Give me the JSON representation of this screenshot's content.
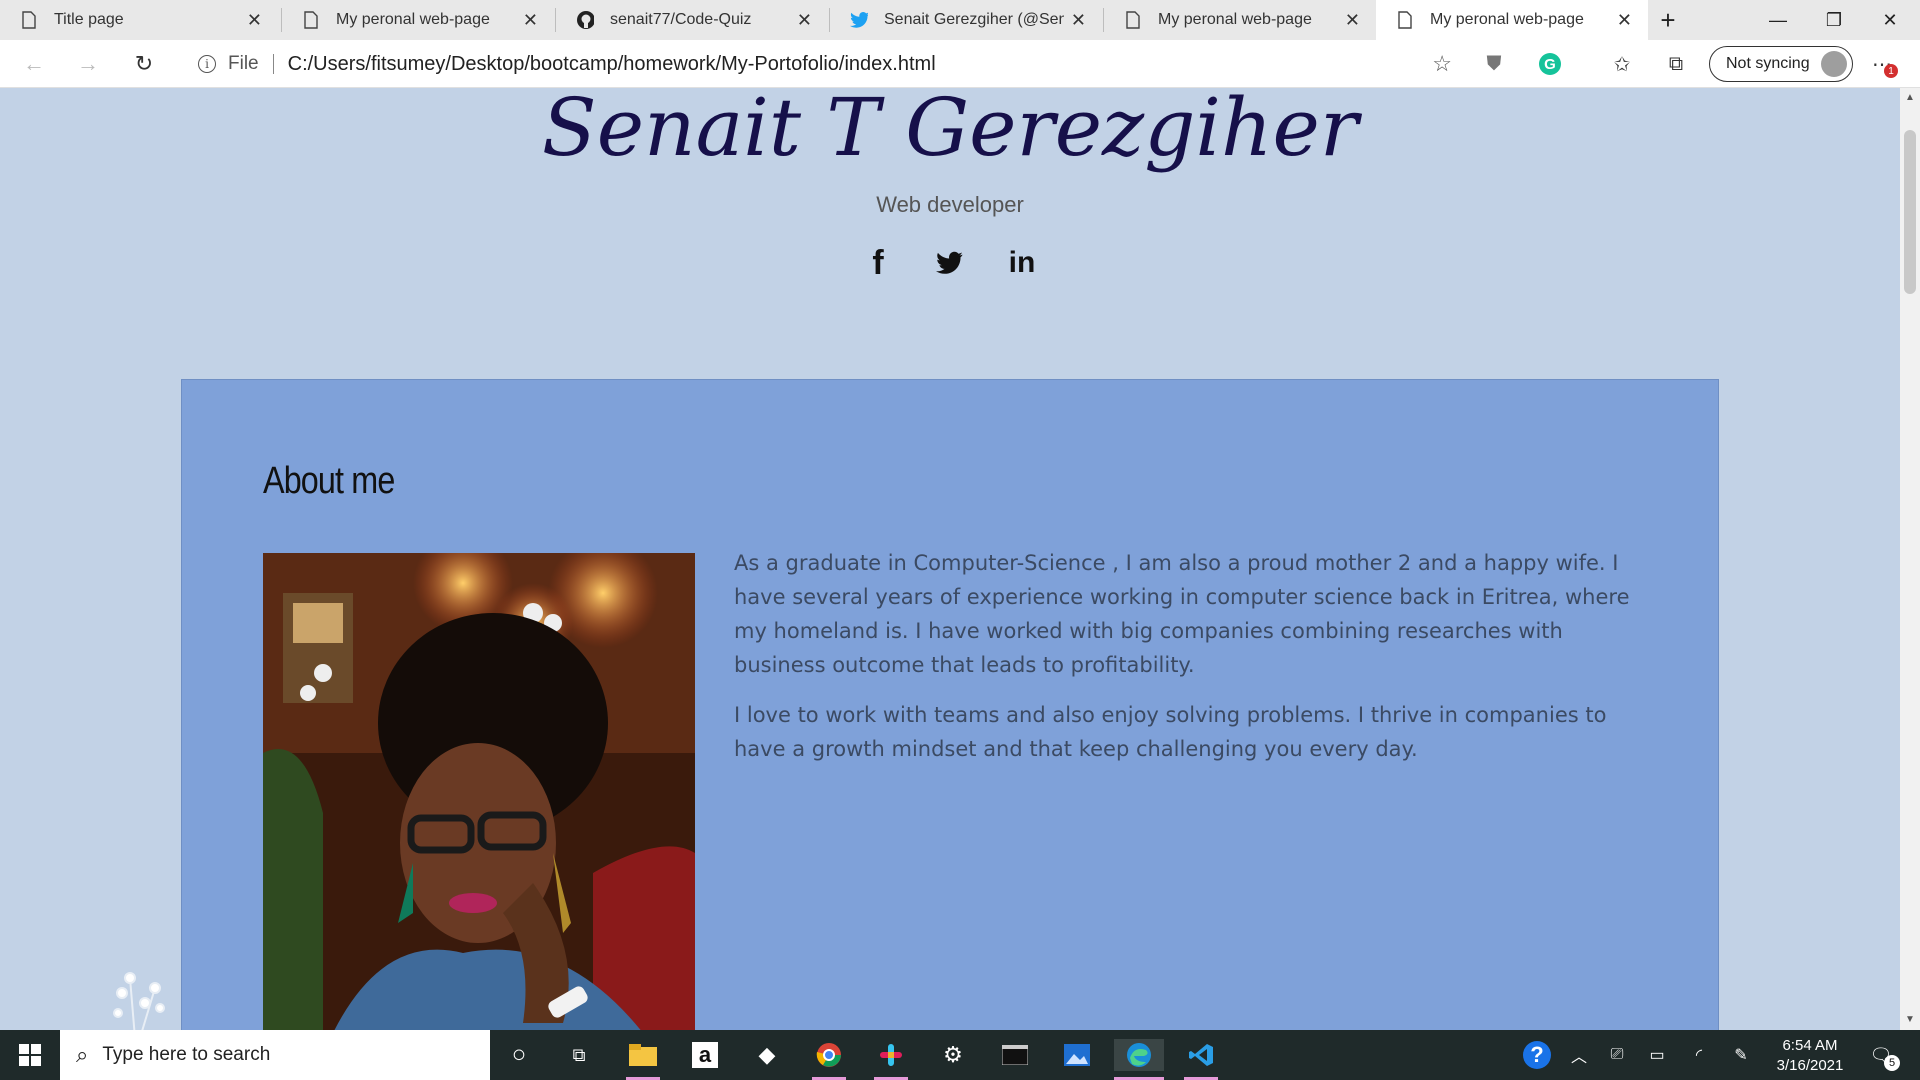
{
  "browser": {
    "tabs": [
      {
        "label": "Title page",
        "icon": "page-icon"
      },
      {
        "label": "My peronal web-page",
        "icon": "page-icon"
      },
      {
        "label": "senait77/Code-Quiz",
        "icon": "github-icon"
      },
      {
        "label": "Senait Gerezgiher (@SenaitG",
        "icon": "twitter-icon"
      },
      {
        "label": "My peronal web-page",
        "icon": "page-icon"
      },
      {
        "label": "My peronal web-page",
        "icon": "page-icon"
      }
    ],
    "active_tab": 5,
    "address": {
      "scheme": "File",
      "url": "C:/Users/fitsumey/Desktop/bootcamp/homework/My-Portofolio/index.html"
    },
    "sync_label": "Not syncing",
    "notification_count": "1"
  },
  "page": {
    "name": "Senait T Gerezgiher",
    "role": "Web developer",
    "social": [
      {
        "icon": "facebook-icon",
        "glyph": "f"
      },
      {
        "icon": "twitter-icon",
        "glyph": "🐦"
      },
      {
        "icon": "linkedin-icon",
        "glyph": "in"
      }
    ],
    "about": {
      "heading": "About me",
      "paragraphs": [
        "As a graduate in Computer-Science , I am also a proud mother 2 and a happy wife. I have several years of experience working in computer science back in Eritrea, where my homeland is. I have worked with big companies combining researches with business outcome that leads to profitability.",
        "I love to work with teams and also enjoy solving problems. I thrive in companies to have a growth mindset and that keep challenging you every day."
      ]
    },
    "colors": {
      "background": "#c2d2e6",
      "about_bg": "#7fa1d9",
      "name": "#16104a"
    }
  },
  "taskbar": {
    "search_placeholder": "Type here to search",
    "time": "6:54 AM",
    "date": "3/16/2021",
    "notifications": "5"
  }
}
